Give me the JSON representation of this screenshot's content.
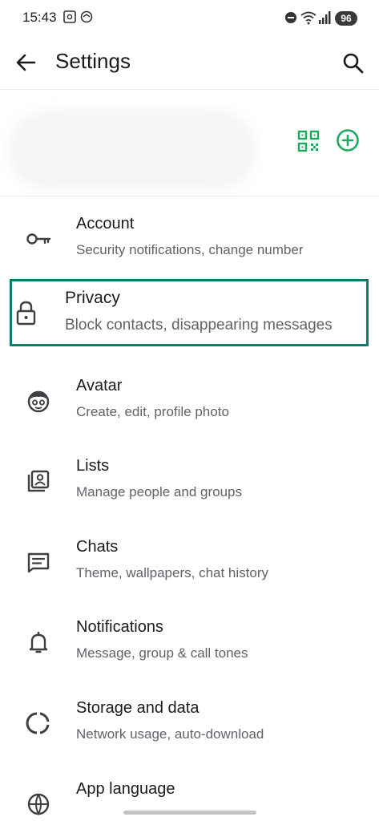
{
  "status_bar": {
    "time": "15:43",
    "battery": "96"
  },
  "header": {
    "title": "Settings"
  },
  "settings": {
    "account": {
      "title": "Account",
      "subtitle": "Security notifications, change number"
    },
    "privacy": {
      "title": "Privacy",
      "subtitle": "Block contacts, disappearing messages"
    },
    "avatar": {
      "title": "Avatar",
      "subtitle": "Create, edit, profile photo"
    },
    "lists": {
      "title": "Lists",
      "subtitle": "Manage people and groups"
    },
    "chats": {
      "title": "Chats",
      "subtitle": "Theme, wallpapers, chat history"
    },
    "notifications": {
      "title": "Notifications",
      "subtitle": "Message, group & call tones"
    },
    "storage": {
      "title": "Storage and data",
      "subtitle": "Network usage, auto-download"
    },
    "app_language": {
      "title": "App language"
    }
  },
  "colors": {
    "accent": "#1DAA61",
    "highlight_border": "#0E7C6B",
    "icon_gray": "#3c4043"
  }
}
